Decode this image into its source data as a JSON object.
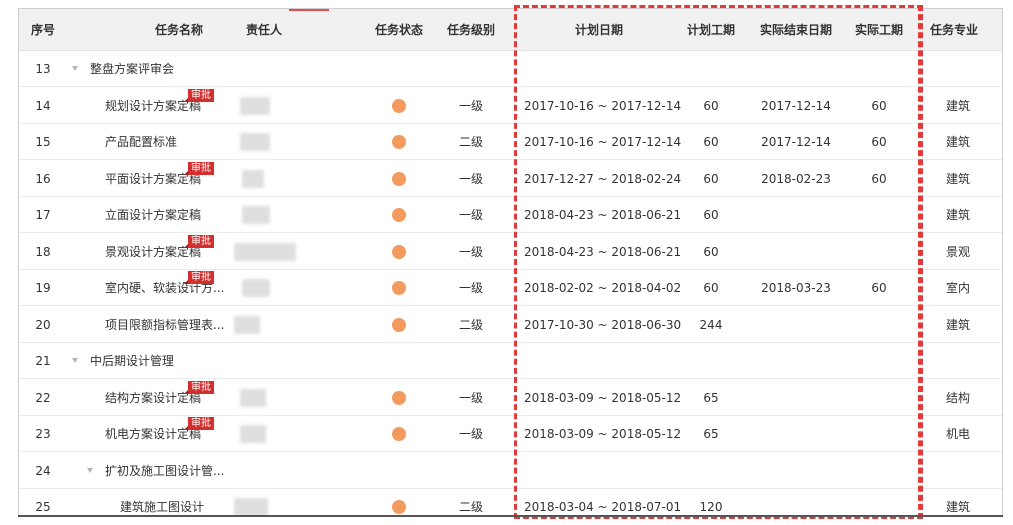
{
  "headers": {
    "index": "序号",
    "name": "任务名称",
    "owner": "责任人",
    "status": "任务状态",
    "level": "任务级别",
    "plan_date": "计划日期",
    "plan_days": "计划工期",
    "actual_end": "实际结束日期",
    "actual_days": "实际工期",
    "discipline": "任务专业"
  },
  "colors": {
    "status_dot": "#f39a5e",
    "approval_badge": "#d32f2f",
    "highlight_dash": "#e03a3a"
  },
  "rows": [
    {
      "index": "13",
      "group": true,
      "name": "整盘方案评审会"
    },
    {
      "index": "14",
      "name": "规划设计方案定稿",
      "badge": "审批",
      "level": "一级",
      "plan_date": "2017-10-16 ~ 2017-12-14",
      "plan_days": "60",
      "actual_end": "2017-12-14",
      "actual_days": "60",
      "discipline": "建筑"
    },
    {
      "index": "15",
      "name": "产品配置标准",
      "level": "二级",
      "plan_date": "2017-10-16 ~ 2017-12-14",
      "plan_days": "60",
      "actual_end": "2017-12-14",
      "actual_days": "60",
      "discipline": "建筑"
    },
    {
      "index": "16",
      "name": "平面设计方案定稿",
      "badge": "审批",
      "level": "一级",
      "plan_date": "2017-12-27 ~ 2018-02-24",
      "plan_days": "60",
      "actual_end": "2018-02-23",
      "actual_days": "60",
      "discipline": "建筑"
    },
    {
      "index": "17",
      "name": "立面设计方案定稿",
      "level": "一级",
      "plan_date": "2018-04-23 ~ 2018-06-21",
      "plan_days": "60",
      "actual_end": "",
      "actual_days": "",
      "discipline": "建筑"
    },
    {
      "index": "18",
      "name": "景观设计方案定稿",
      "badge": "审批",
      "level": "一级",
      "plan_date": "2018-04-23 ~ 2018-06-21",
      "plan_days": "60",
      "actual_end": "",
      "actual_days": "",
      "discipline": "景观"
    },
    {
      "index": "19",
      "name": "室内硬、软装设计方...",
      "badge": "审批",
      "level": "一级",
      "plan_date": "2018-02-02 ~ 2018-04-02",
      "plan_days": "60",
      "actual_end": "2018-03-23",
      "actual_days": "60",
      "discipline": "室内"
    },
    {
      "index": "20",
      "name": "项目限额指标管理表...",
      "level": "二级",
      "plan_date": "2017-10-30 ~ 2018-06-30",
      "plan_days": "244",
      "actual_end": "",
      "actual_days": "",
      "discipline": "建筑"
    },
    {
      "index": "21",
      "group": true,
      "name": "中后期设计管理"
    },
    {
      "index": "22",
      "name": "结构方案设计定稿",
      "badge": "审批",
      "level": "一级",
      "plan_date": "2018-03-09 ~ 2018-05-12",
      "plan_days": "65",
      "actual_end": "",
      "actual_days": "",
      "discipline": "结构"
    },
    {
      "index": "23",
      "name": "机电方案设计定稿",
      "badge": "审批",
      "level": "一级",
      "plan_date": "2018-03-09 ~ 2018-05-12",
      "plan_days": "65",
      "actual_end": "",
      "actual_days": "",
      "discipline": "机电"
    },
    {
      "index": "24",
      "group": true,
      "subgroup": true,
      "name": "扩初及施工图设计管..."
    },
    {
      "index": "25",
      "name": "建筑施工图设计",
      "subitem": true,
      "level": "二级",
      "plan_date": "2018-03-04 ~ 2018-07-01",
      "plan_days": "120",
      "actual_end": "",
      "actual_days": "",
      "discipline": "建筑"
    }
  ]
}
